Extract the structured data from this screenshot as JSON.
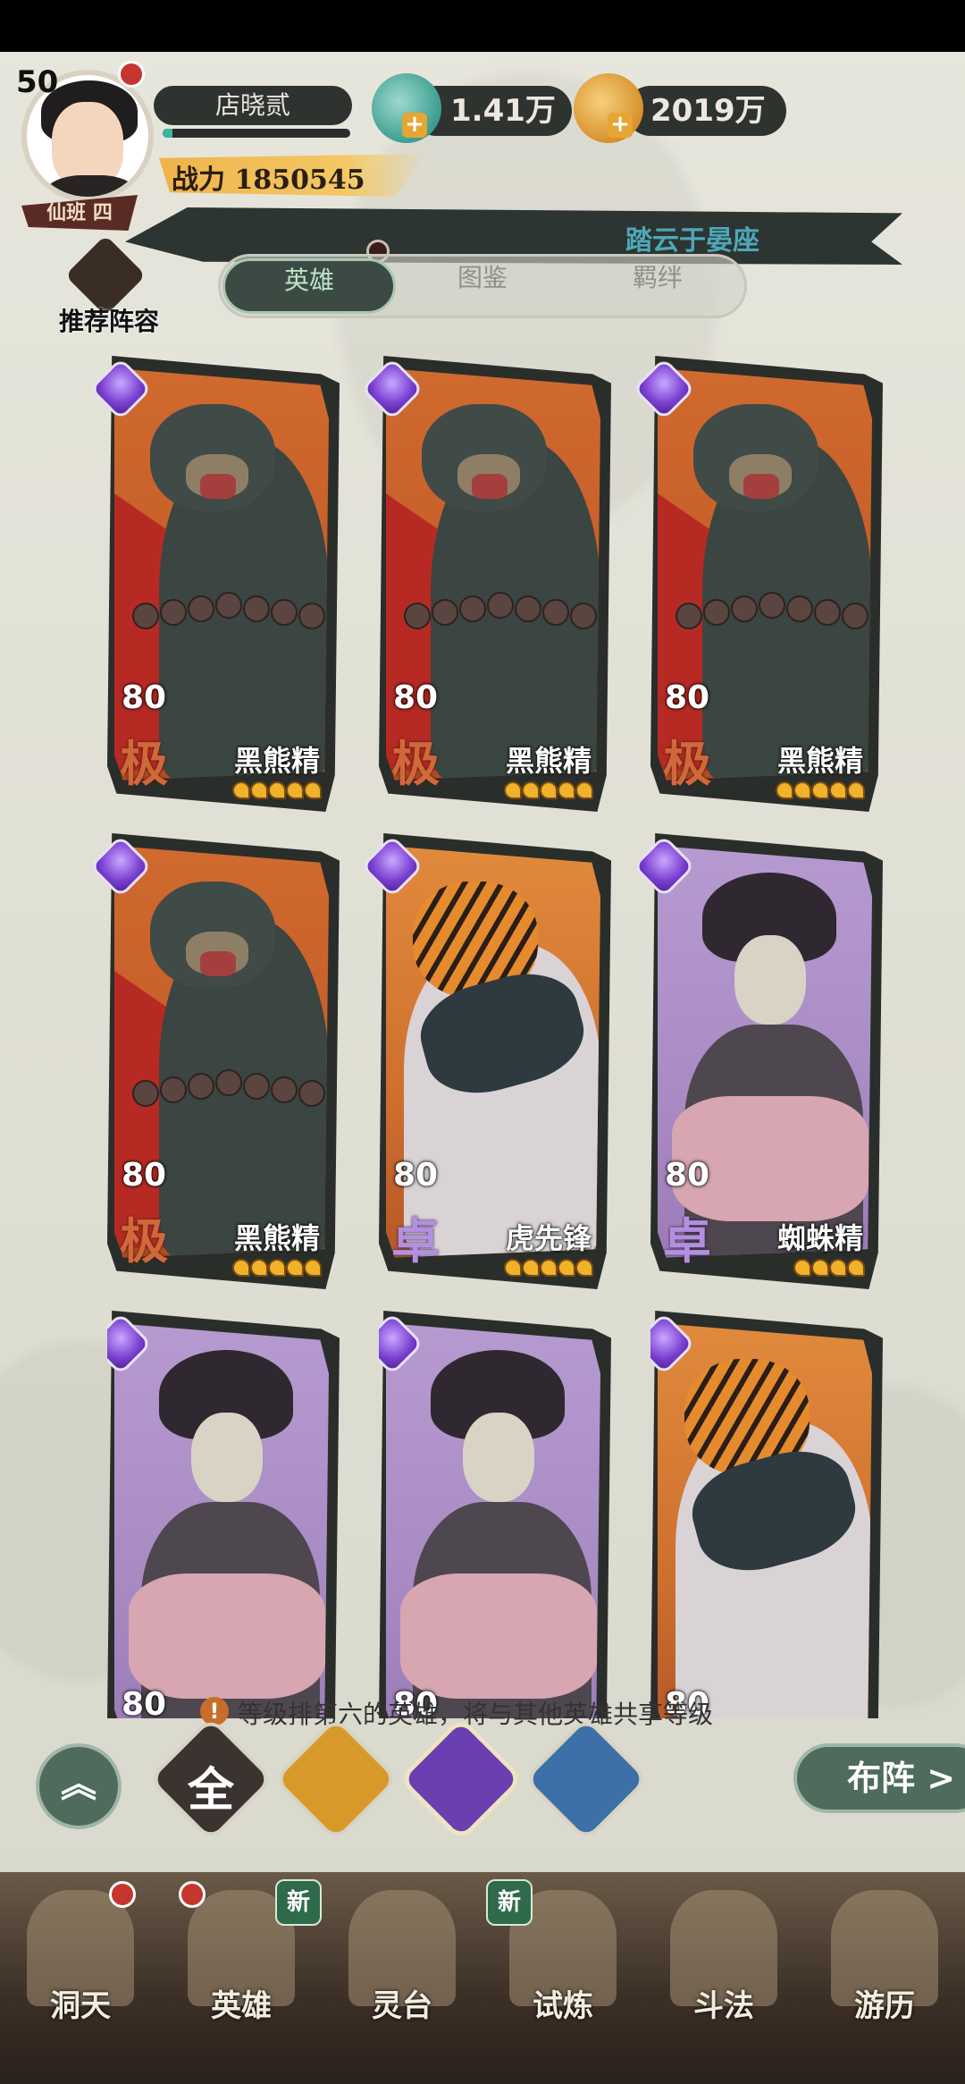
{
  "player": {
    "level": "50",
    "name": "店晓贰",
    "power_label": "战力",
    "power_value": "1850545",
    "rank_plate": "仙班 四",
    "exp_progress": 0.05
  },
  "resources": {
    "jade": {
      "value": "1.41万",
      "icon": "jade-fish-icon"
    },
    "coins": {
      "value": "2019万",
      "icon": "copper-coin-icon"
    }
  },
  "banner": {
    "text": "踏云于晏座"
  },
  "recommend": {
    "label": "推荐阵容"
  },
  "tabs": [
    {
      "label": "英雄",
      "active": true
    },
    {
      "label": "图鉴",
      "active": false
    },
    {
      "label": "羁绊",
      "active": false
    }
  ],
  "cards": [
    {
      "level": "80",
      "grade": "极",
      "name": "黑熊精",
      "type": "bear",
      "stars": 5
    },
    {
      "level": "80",
      "grade": "极",
      "name": "黑熊精",
      "type": "bear",
      "stars": 5
    },
    {
      "level": "80",
      "grade": "极",
      "name": "黑熊精",
      "type": "bear",
      "stars": 5
    },
    {
      "level": "80",
      "grade": "极",
      "name": "黑熊精",
      "type": "bear",
      "stars": 5
    },
    {
      "level": "80",
      "grade": "卓",
      "name": "虎先锋",
      "type": "tiger",
      "stars": 5
    },
    {
      "level": "80",
      "grade": "卓",
      "name": "蜘蛛精",
      "type": "spider",
      "stars": 4
    },
    {
      "level": "80",
      "grade": "",
      "name": "",
      "type": "spider",
      "stars": 0
    },
    {
      "level": "80",
      "grade": "",
      "name": "",
      "type": "spider",
      "stars": 0
    },
    {
      "level": "80",
      "grade": "",
      "name": "",
      "type": "tiger",
      "stars": 0
    }
  ],
  "info": {
    "text": "等级排第六的英雄，将与其他英雄共享等级"
  },
  "filters": [
    {
      "label": "全",
      "icon": "all-filter-icon",
      "color": "#3a3330"
    },
    {
      "label": "",
      "icon": "gold-gourd-filter-icon",
      "color": "#d79a2a"
    },
    {
      "label": "",
      "icon": "purple-gem-filter-icon",
      "color": "#6a3fb0"
    },
    {
      "label": "",
      "icon": "blue-fox-filter-icon",
      "color": "#3d6fa8"
    }
  ],
  "collapse_button": {
    "label": "︽"
  },
  "formation_button": {
    "label": "布阵 >"
  },
  "nav": [
    {
      "label": "洞天",
      "badge": "dot"
    },
    {
      "label": "英雄",
      "badge": "dot"
    },
    {
      "label": "灵台",
      "badge": "新"
    },
    {
      "label": "试炼",
      "badge": "新"
    },
    {
      "label": "斗法",
      "badge": ""
    },
    {
      "label": "游历",
      "badge": ""
    }
  ]
}
